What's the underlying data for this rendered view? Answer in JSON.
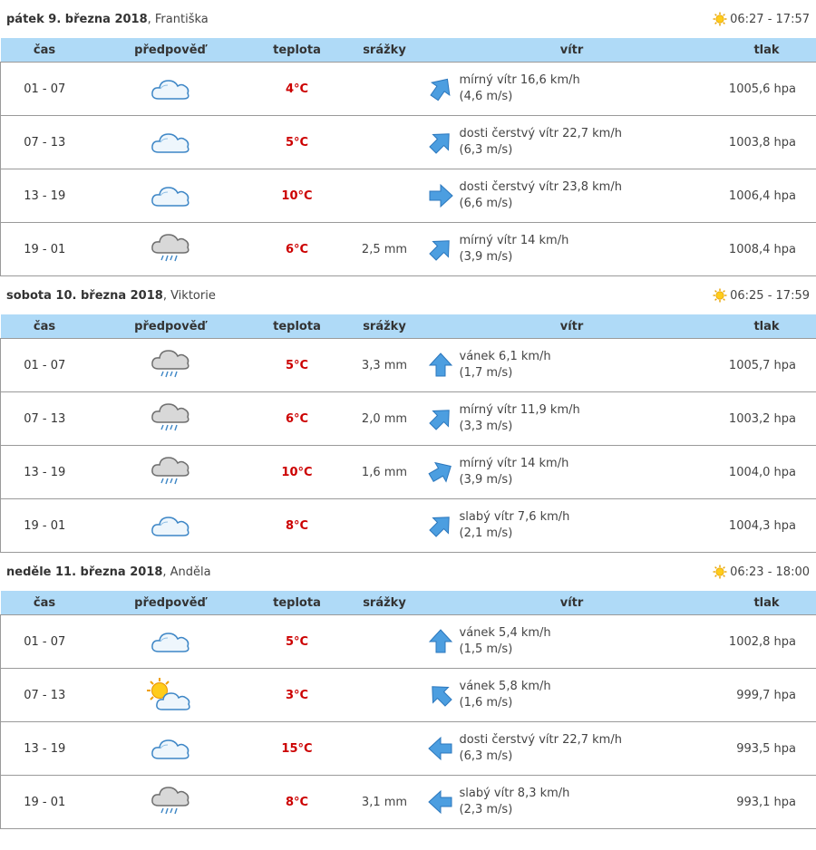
{
  "days": [
    {
      "date": "pátek 9. března 2018",
      "name": ", Františka",
      "sun": "06:27 - 17:57",
      "columns": [
        "čas",
        "předpověď",
        "teplota",
        "srážky",
        "vítr",
        "tlak"
      ],
      "rows": [
        {
          "time": "01 - 07",
          "icon": "cloudy-icon",
          "temp": "4°C",
          "rain": "",
          "wind_dir_deg": 35,
          "wind1": "mírný vítr 16,6 km/h",
          "wind2": "(4,6 m/s)",
          "pressure": "1005,6 hpa"
        },
        {
          "time": "07 - 13",
          "icon": "cloudy-icon",
          "temp": "5°C",
          "rain": "",
          "wind_dir_deg": 45,
          "wind1": "dosti čerstvý vítr 22,7 km/h",
          "wind2": "(6,3 m/s)",
          "pressure": "1003,8 hpa"
        },
        {
          "time": "13 - 19",
          "icon": "cloudy-icon",
          "temp": "10°C",
          "rain": "",
          "wind_dir_deg": 90,
          "wind1": "dosti čerstvý vítr 23,8 km/h",
          "wind2": "(6,6 m/s)",
          "pressure": "1006,4 hpa"
        },
        {
          "time": "19 - 01",
          "icon": "rain-icon",
          "temp": "6°C",
          "rain": "2,5 mm",
          "wind_dir_deg": 45,
          "wind1": "mírný vítr 14 km/h",
          "wind2": "(3,9 m/s)",
          "pressure": "1008,4 hpa"
        }
      ]
    },
    {
      "date": "sobota 10. března 2018",
      "name": ", Viktorie",
      "sun": "06:25 - 17:59",
      "columns": [
        "čas",
        "předpověď",
        "teplota",
        "srážky",
        "vítr",
        "tlak"
      ],
      "rows": [
        {
          "time": "01 - 07",
          "icon": "rain-icon",
          "temp": "5°C",
          "rain": "3,3 mm",
          "wind_dir_deg": 0,
          "wind1": "vánek 6,1 km/h",
          "wind2": "(1,7 m/s)",
          "pressure": "1005,7 hpa"
        },
        {
          "time": "07 - 13",
          "icon": "rain-icon",
          "temp": "6°C",
          "rain": "2,0 mm",
          "wind_dir_deg": 45,
          "wind1": "mírný vítr 11,9 km/h",
          "wind2": "(3,3 m/s)",
          "pressure": "1003,2 hpa"
        },
        {
          "time": "13 - 19",
          "icon": "rain-icon",
          "temp": "10°C",
          "rain": "1,6 mm",
          "wind_dir_deg": 60,
          "wind1": "mírný vítr 14 km/h",
          "wind2": "(3,9 m/s)",
          "pressure": "1004,0 hpa"
        },
        {
          "time": "19 - 01",
          "icon": "cloudy-icon",
          "temp": "8°C",
          "rain": "",
          "wind_dir_deg": 45,
          "wind1": "slabý vítr 7,6 km/h",
          "wind2": "(2,1 m/s)",
          "pressure": "1004,3 hpa"
        }
      ]
    },
    {
      "date": "neděle 11. března 2018",
      "name": ", Anděla",
      "sun": "06:23 - 18:00",
      "columns": [
        "čas",
        "předpověď",
        "teplota",
        "srážky",
        "vítr",
        "tlak"
      ],
      "rows": [
        {
          "time": "01 - 07",
          "icon": "cloudy-icon",
          "temp": "5°C",
          "rain": "",
          "wind_dir_deg": 0,
          "wind1": "vánek 5,4 km/h",
          "wind2": "(1,5 m/s)",
          "pressure": "1002,8 hpa"
        },
        {
          "time": "07 - 13",
          "icon": "partly-sunny-icon",
          "temp": "3°C",
          "rain": "",
          "wind_dir_deg": -45,
          "wind1": "vánek 5,8 km/h",
          "wind2": "(1,6 m/s)",
          "pressure": "999,7 hpa"
        },
        {
          "time": "13 - 19",
          "icon": "cloudy-icon",
          "temp": "15°C",
          "rain": "",
          "wind_dir_deg": -90,
          "wind1": "dosti čerstvý vítr 22,7 km/h",
          "wind2": "(6,3 m/s)",
          "pressure": "993,5 hpa"
        },
        {
          "time": "19 - 01",
          "icon": "rain-icon",
          "temp": "8°C",
          "rain": "3,1 mm",
          "wind_dir_deg": -90,
          "wind1": "slabý vítr 8,3 km/h",
          "wind2": "(2,3 m/s)",
          "pressure": "993,1 hpa"
        }
      ]
    }
  ]
}
